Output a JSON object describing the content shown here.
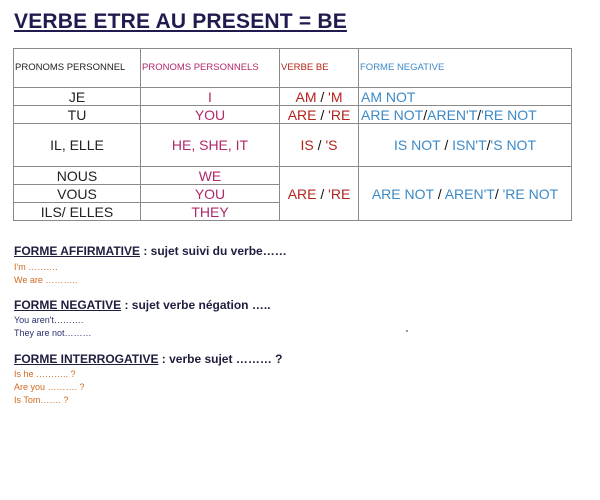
{
  "title": "VERBE ETRE AU PRESENT = BE",
  "table": {
    "headers": [
      "PRONOMS PERSONNEL",
      "PRONOMS PERSONNELS",
      "VERBE BE",
      "FORME NEGATIVE"
    ],
    "rows": {
      "je": {
        "fr": "JE",
        "en": "I",
        "be_a": "AM",
        "be_b": "'M",
        "neg_a": "AM NOT"
      },
      "tu": {
        "fr": "TU",
        "en": "YOU",
        "be_a": "ARE",
        "be_b": "'RE",
        "neg_a": "ARE NOT",
        "neg_b": "AREN'T",
        "neg_c": "'RE NOT"
      },
      "il": {
        "fr": "IL, ELLE",
        "en": "HE, SHE, IT",
        "be_a": "IS",
        "be_b": "'S",
        "neg_a": "IS NOT",
        "neg_b": "ISN'T",
        "neg_c": "'S NOT"
      },
      "nous": {
        "fr": "NOUS",
        "en": "WE"
      },
      "vous": {
        "fr": "VOUS",
        "en": "YOU"
      },
      "ils": {
        "fr": "ILS/ ELLES",
        "en": "THEY"
      },
      "plural": {
        "be_a": "ARE",
        "be_b": "'RE",
        "neg_a": "ARE NOT",
        "neg_b": "AREN'T",
        "neg_c": "'RE NOT"
      }
    },
    "separator": "/"
  },
  "sections": {
    "affirmative": {
      "label": "FORME AFFIRMATIVE",
      "rest": " : sujet suivi du verbe……",
      "examples": [
        "I'm ……….",
        "We are ……….."
      ]
    },
    "negative": {
      "label": "FORME NEGATIVE",
      "rest": " : sujet verbe négation …..",
      "examples": [
        "You aren't……….",
        "They are not………"
      ]
    },
    "interrogative": {
      "label": "FORME INTERROGATIVE",
      "rest": " : verbe sujet ……… ?",
      "examples": [
        "Is he ……….. ?",
        "Are you ………. ?",
        "Is Tom……. ?"
      ]
    }
  }
}
